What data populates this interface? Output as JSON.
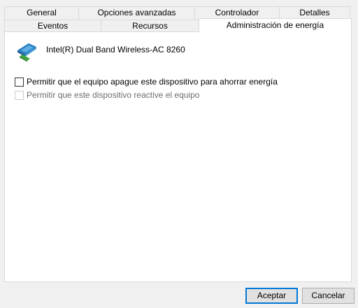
{
  "tabs": {
    "back_row": [
      "General",
      "Opciones avanzadas",
      "Controlador",
      "Detalles"
    ],
    "front_row": [
      "Eventos",
      "Recursos",
      "Administración de energía"
    ],
    "selected": "Administración de energía"
  },
  "device": {
    "icon": "network-adapter-icon",
    "name": "Intel(R) Dual Band Wireless-AC 8260"
  },
  "options": [
    {
      "label": "Permitir que el equipo apague este dispositivo para ahorrar energía",
      "checked": false,
      "enabled": true
    },
    {
      "label": "Permitir que este dispositivo reactive el equipo",
      "checked": false,
      "enabled": false
    }
  ],
  "buttons": {
    "ok_label": "Aceptar",
    "cancel_label": "Cancelar"
  },
  "colors": {
    "accent": "#0078d7",
    "window_bg": "#f0f0f0",
    "panel_bg": "#ffffff",
    "disabled_text": "#6d6d6d"
  }
}
